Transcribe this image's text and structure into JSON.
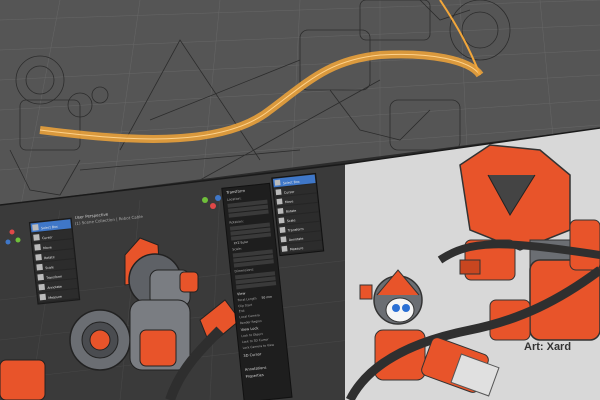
{
  "scene": {
    "accent_wire": "#f2a63a",
    "robot_orange": "#e8542a",
    "robot_gray": "#6b6e73",
    "panel_bg": "#1e1e1e",
    "viewport_bg": "#3a3a3a",
    "highlight": "#3f77c8"
  },
  "viewport": {
    "header_line1": "User Perspective",
    "header_line2": "(1) Scene Collection | Robot Cable"
  },
  "toolbar": {
    "items": [
      {
        "icon": "select-box-icon",
        "label": "Select Box"
      },
      {
        "icon": "cursor-icon",
        "label": "Cursor"
      },
      {
        "icon": "move-icon",
        "label": "Move"
      },
      {
        "icon": "rotate-icon",
        "label": "Rotate"
      },
      {
        "icon": "scale-icon",
        "label": "Scale"
      },
      {
        "icon": "transform-icon",
        "label": "Transform"
      },
      {
        "icon": "annotate-icon",
        "label": "Annotate"
      },
      {
        "icon": "measure-icon",
        "label": "Measure"
      }
    ]
  },
  "transform_panel": {
    "title": "Transform",
    "location_label": "Location:",
    "rotation_label": "Rotation:",
    "mode_value": "XYZ Euler",
    "scale_label": "Scale:",
    "dimensions_label": "Dimensions:",
    "view_title": "View",
    "focal_length_label": "Focal Length",
    "focal_length_value": "50 mm",
    "clip_start_label": "Clip Start",
    "clip_end_label": "End",
    "local_camera_label": "Local Camera",
    "render_region_label": "Render Region",
    "view_lock_title": "View Lock",
    "lock_object_label": "Lock to Object",
    "lock_cursor_label": "Lock to 3D Cursor",
    "lock_camera_label": "Lock Camera to View",
    "cursor_title": "3D Cursor",
    "annotations_title": "Annotations",
    "properties_title": "Properties"
  },
  "credit": "Art: Xard"
}
